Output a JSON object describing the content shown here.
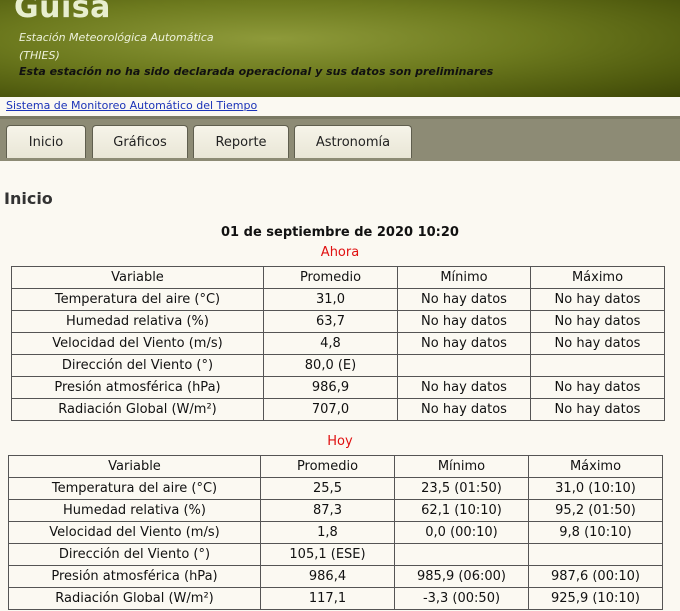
{
  "header": {
    "title": "Guisa",
    "subtitle": "Estación Meteorológica Automática",
    "code": "(THIES)",
    "warning": "Esta estación no ha sido declarada operacional y sus datos son preliminares"
  },
  "link": {
    "label": "Sistema de Monitoreo Automático del Tiempo"
  },
  "tabs": [
    {
      "label": "Inicio"
    },
    {
      "label": "Gráficos"
    },
    {
      "label": "Reporte"
    },
    {
      "label": "Astronomía"
    }
  ],
  "page": {
    "title": "Inicio",
    "datetime": "01 de septiembre de 2020 10:20"
  },
  "now": {
    "caption": "Ahora",
    "columns": [
      "Variable",
      "Promedio",
      "Mínimo",
      "Máximo"
    ],
    "rows": [
      [
        "Temperatura del aire (°C)",
        "31,0",
        "No hay datos",
        "No hay datos"
      ],
      [
        "Humedad relativa (%)",
        "63,7",
        "No hay datos",
        "No hay datos"
      ],
      [
        "Velocidad del Viento (m/s)",
        "4,8",
        "No hay datos",
        "No hay datos"
      ],
      [
        "Dirección del Viento (°)",
        "80,0 (E)",
        "",
        ""
      ],
      [
        "Presión atmosférica (hPa)",
        "986,9",
        "No hay datos",
        "No hay datos"
      ],
      [
        "Radiación Global (W/m²)",
        "707,0",
        "No hay datos",
        "No hay datos"
      ]
    ]
  },
  "today": {
    "caption": "Hoy",
    "columns": [
      "Variable",
      "Promedio",
      "Mínimo",
      "Máximo"
    ],
    "rows": [
      [
        "Temperatura del aire (°C)",
        "25,5",
        "23,5 (01:50)",
        "31,0 (10:10)"
      ],
      [
        "Humedad relativa (%)",
        "87,3",
        "62,1 (10:10)",
        "95,2 (01:50)"
      ],
      [
        "Velocidad del Viento (m/s)",
        "1,8",
        "0,0 (00:10)",
        "9,8 (10:10)"
      ],
      [
        "Dirección del Viento (°)",
        "105,1 (ESE)",
        "",
        ""
      ],
      [
        "Presión atmosférica (hPa)",
        "986,4",
        "985,9 (06:00)",
        "987,6 (00:10)"
      ],
      [
        "Radiación Global (W/m²)",
        "117,1",
        "-3,3 (00:50)",
        "925,9 (10:10)"
      ]
    ]
  }
}
